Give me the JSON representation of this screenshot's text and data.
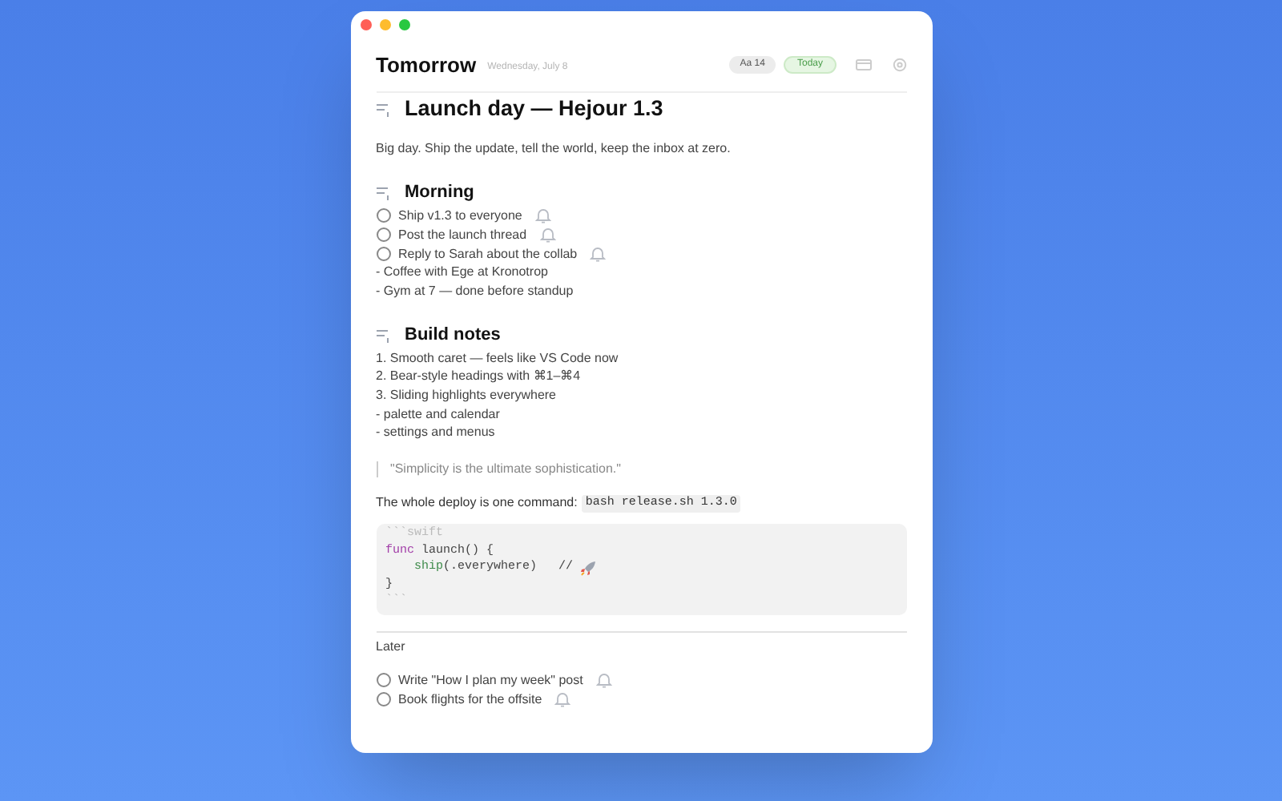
{
  "window": {
    "title": "Tomorrow",
    "date": "Wednesday, July 8"
  },
  "toolbar": {
    "font_size": "Aa 14",
    "today": "Today"
  },
  "blocks": [
    {
      "kind": "h1",
      "text": "Launch day — Hejour 1.3"
    },
    {
      "kind": "para",
      "text": "Big day. Ship the update, tell the world, keep the inbox at zero."
    },
    {
      "kind": "h2",
      "text": "Morning"
    },
    {
      "kind": "task",
      "text": "Ship v1.3 to everyone",
      "checked": false
    },
    {
      "kind": "task",
      "text": "Post the launch thread",
      "checked": false
    },
    {
      "kind": "task",
      "text": "Reply to Sarah about the collab",
      "checked": false
    },
    {
      "kind": "line",
      "text": "- Coffee with Ege at Kronotrop"
    },
    {
      "kind": "line",
      "text": "- Gym at 7 — done before standup"
    },
    {
      "kind": "h2",
      "text": "Build notes"
    },
    {
      "kind": "line",
      "text": "1. Smooth caret — feels like VS Code now"
    },
    {
      "kind": "line",
      "text": "2. Bear-style headings with ⌘1–⌘4"
    },
    {
      "kind": "line",
      "text": "3. Sliding highlights everywhere"
    },
    {
      "kind": "line",
      "text": "- palette and calendar"
    },
    {
      "kind": "line",
      "text": "- settings and menus"
    },
    {
      "kind": "quote",
      "text": "\"Simplicity is the ultimate sophistication.\""
    },
    {
      "kind": "inline_code",
      "text": "The whole deploy is one command:",
      "code": "bash release.sh 1.3.0"
    },
    {
      "kind": "code",
      "fence_open": "```swift",
      "fence_close": "```",
      "lines": [
        [
          {
            "t": "func",
            "color": "#a23ea8"
          },
          {
            "t": " launch() {",
            "color": "#444444"
          }
        ],
        [
          {
            "t": "    ship",
            "color": "#3d8a4a"
          },
          {
            "t": "(.everywhere)   // ",
            "color": "#444444"
          }
        ],
        [
          {
            "t": "}",
            "color": "#444444"
          }
        ]
      ]
    },
    {
      "kind": "divider"
    },
    {
      "kind": "label",
      "text": "Later"
    },
    {
      "kind": "task",
      "text": "Write \"How I plan my week\" post",
      "checked": false
    },
    {
      "kind": "task",
      "text": "Book flights for the offsite",
      "checked": false
    }
  ]
}
